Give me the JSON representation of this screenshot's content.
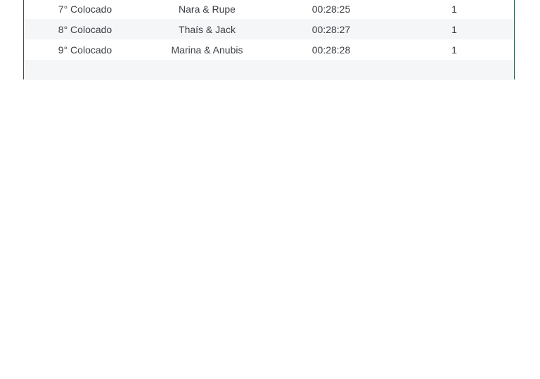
{
  "table": {
    "rows": [
      {
        "position": "7° Colocado",
        "team": "Nara & Rupe",
        "time": "00:28:25",
        "count": "1"
      },
      {
        "position": "8° Colocado",
        "team": "Thaís & Jack",
        "time": "00:28:27",
        "count": "1"
      },
      {
        "position": "9° Colocado",
        "team": "Marina & Anubis",
        "time": "00:28:28",
        "count": "1"
      }
    ]
  }
}
